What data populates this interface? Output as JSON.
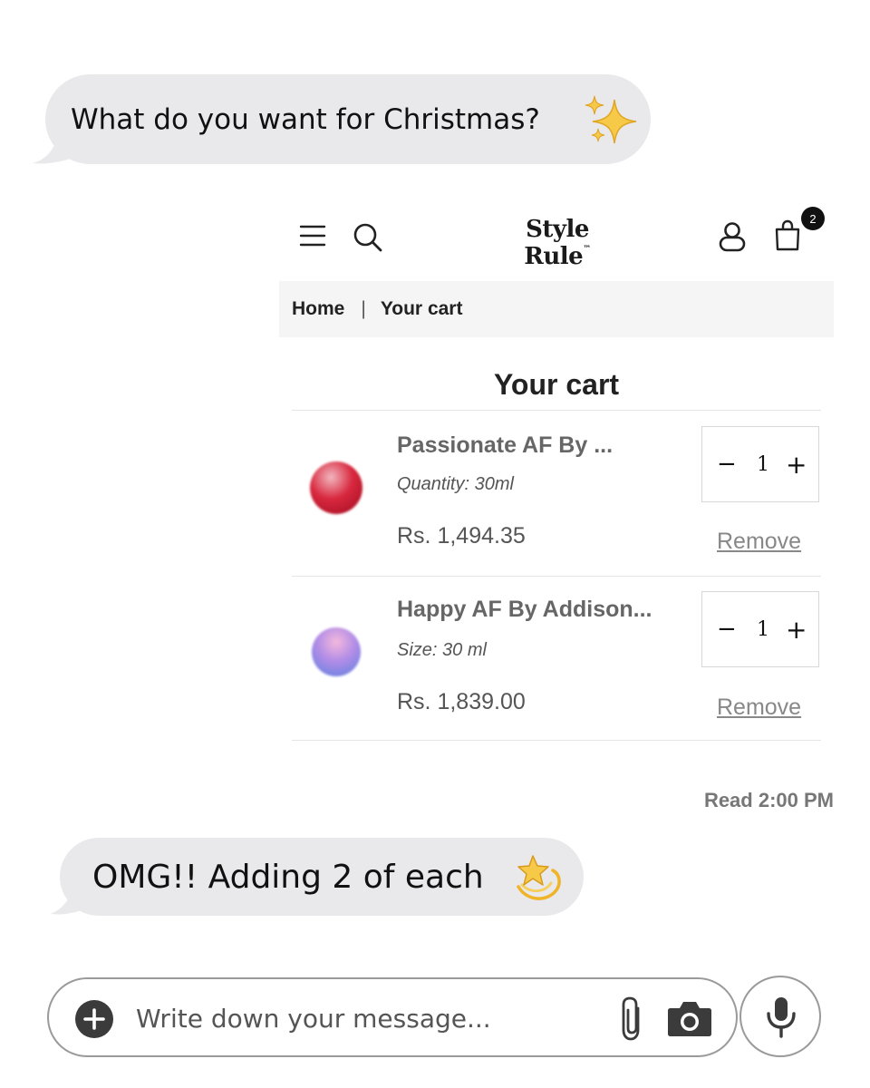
{
  "messages": [
    {
      "text": "What do you want for Christmas?",
      "emoji": "sparkles",
      "side": "left"
    },
    {
      "text": "OMG!! Adding 2 of each",
      "emoji": "dizzy",
      "side": "left"
    }
  ],
  "read_receipt": "Read 2:00 PM",
  "store": {
    "brand": "Style Rule",
    "brand_mark": "™",
    "cart_count": "2",
    "breadcrumb": {
      "home": "Home",
      "separator": "|",
      "current": "Your cart"
    },
    "cart_title": "Your cart",
    "items": [
      {
        "name": "Passionate AF By ...",
        "variant": "Quantity: 30ml",
        "price": "Rs. 1,494.35",
        "qty": "1",
        "remove": "Remove",
        "swatch": "#c0122a"
      },
      {
        "name": "Happy AF By Addison...",
        "variant": "Size: 30 ml",
        "price": "Rs. 1,839.00",
        "qty": "1",
        "remove": "Remove",
        "swatch": "#7a8ee8"
      }
    ],
    "icons": [
      "menu-icon",
      "search-icon",
      "user-icon",
      "bag-icon"
    ]
  },
  "composer": {
    "placeholder": "Write down your message...",
    "icons": [
      "plus-circle-icon",
      "paperclip-icon",
      "camera-icon",
      "microphone-icon"
    ]
  },
  "colors": {
    "bubble": "#e9e9eb",
    "badge": "#111111"
  }
}
